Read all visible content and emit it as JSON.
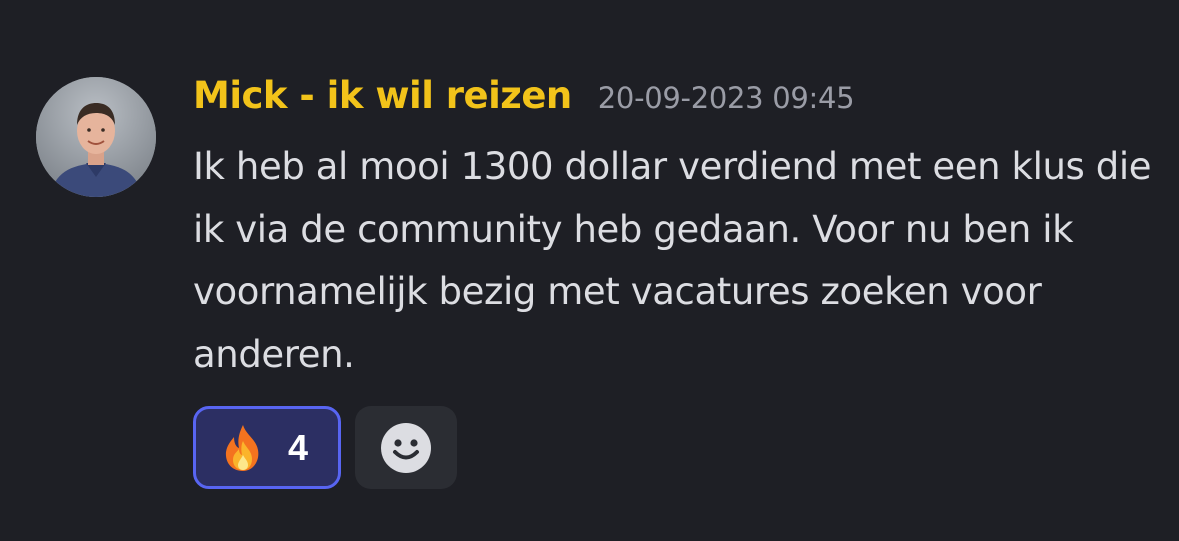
{
  "message": {
    "author": "Mick - ik wil reizen",
    "timestamp": "20-09-2023 09:45",
    "text": "Ik heb al mooi 1300 dollar verdiend met een klus die ik via de community heb gedaan. Voor nu ben ik voornamelijk bezig met vacatures zoeken voor anderen.",
    "reactions": [
      {
        "emoji": "fire-emoji",
        "count": "4",
        "selected": true
      }
    ],
    "add_reaction_icon": "smiley-icon"
  },
  "colors": {
    "background": "#1e1f25",
    "username": "#f2c31a",
    "timestamp": "#9a9ca6",
    "text": "#dcdde2",
    "reaction_border": "#5865f2",
    "reaction_bg": "#2c2f63"
  }
}
